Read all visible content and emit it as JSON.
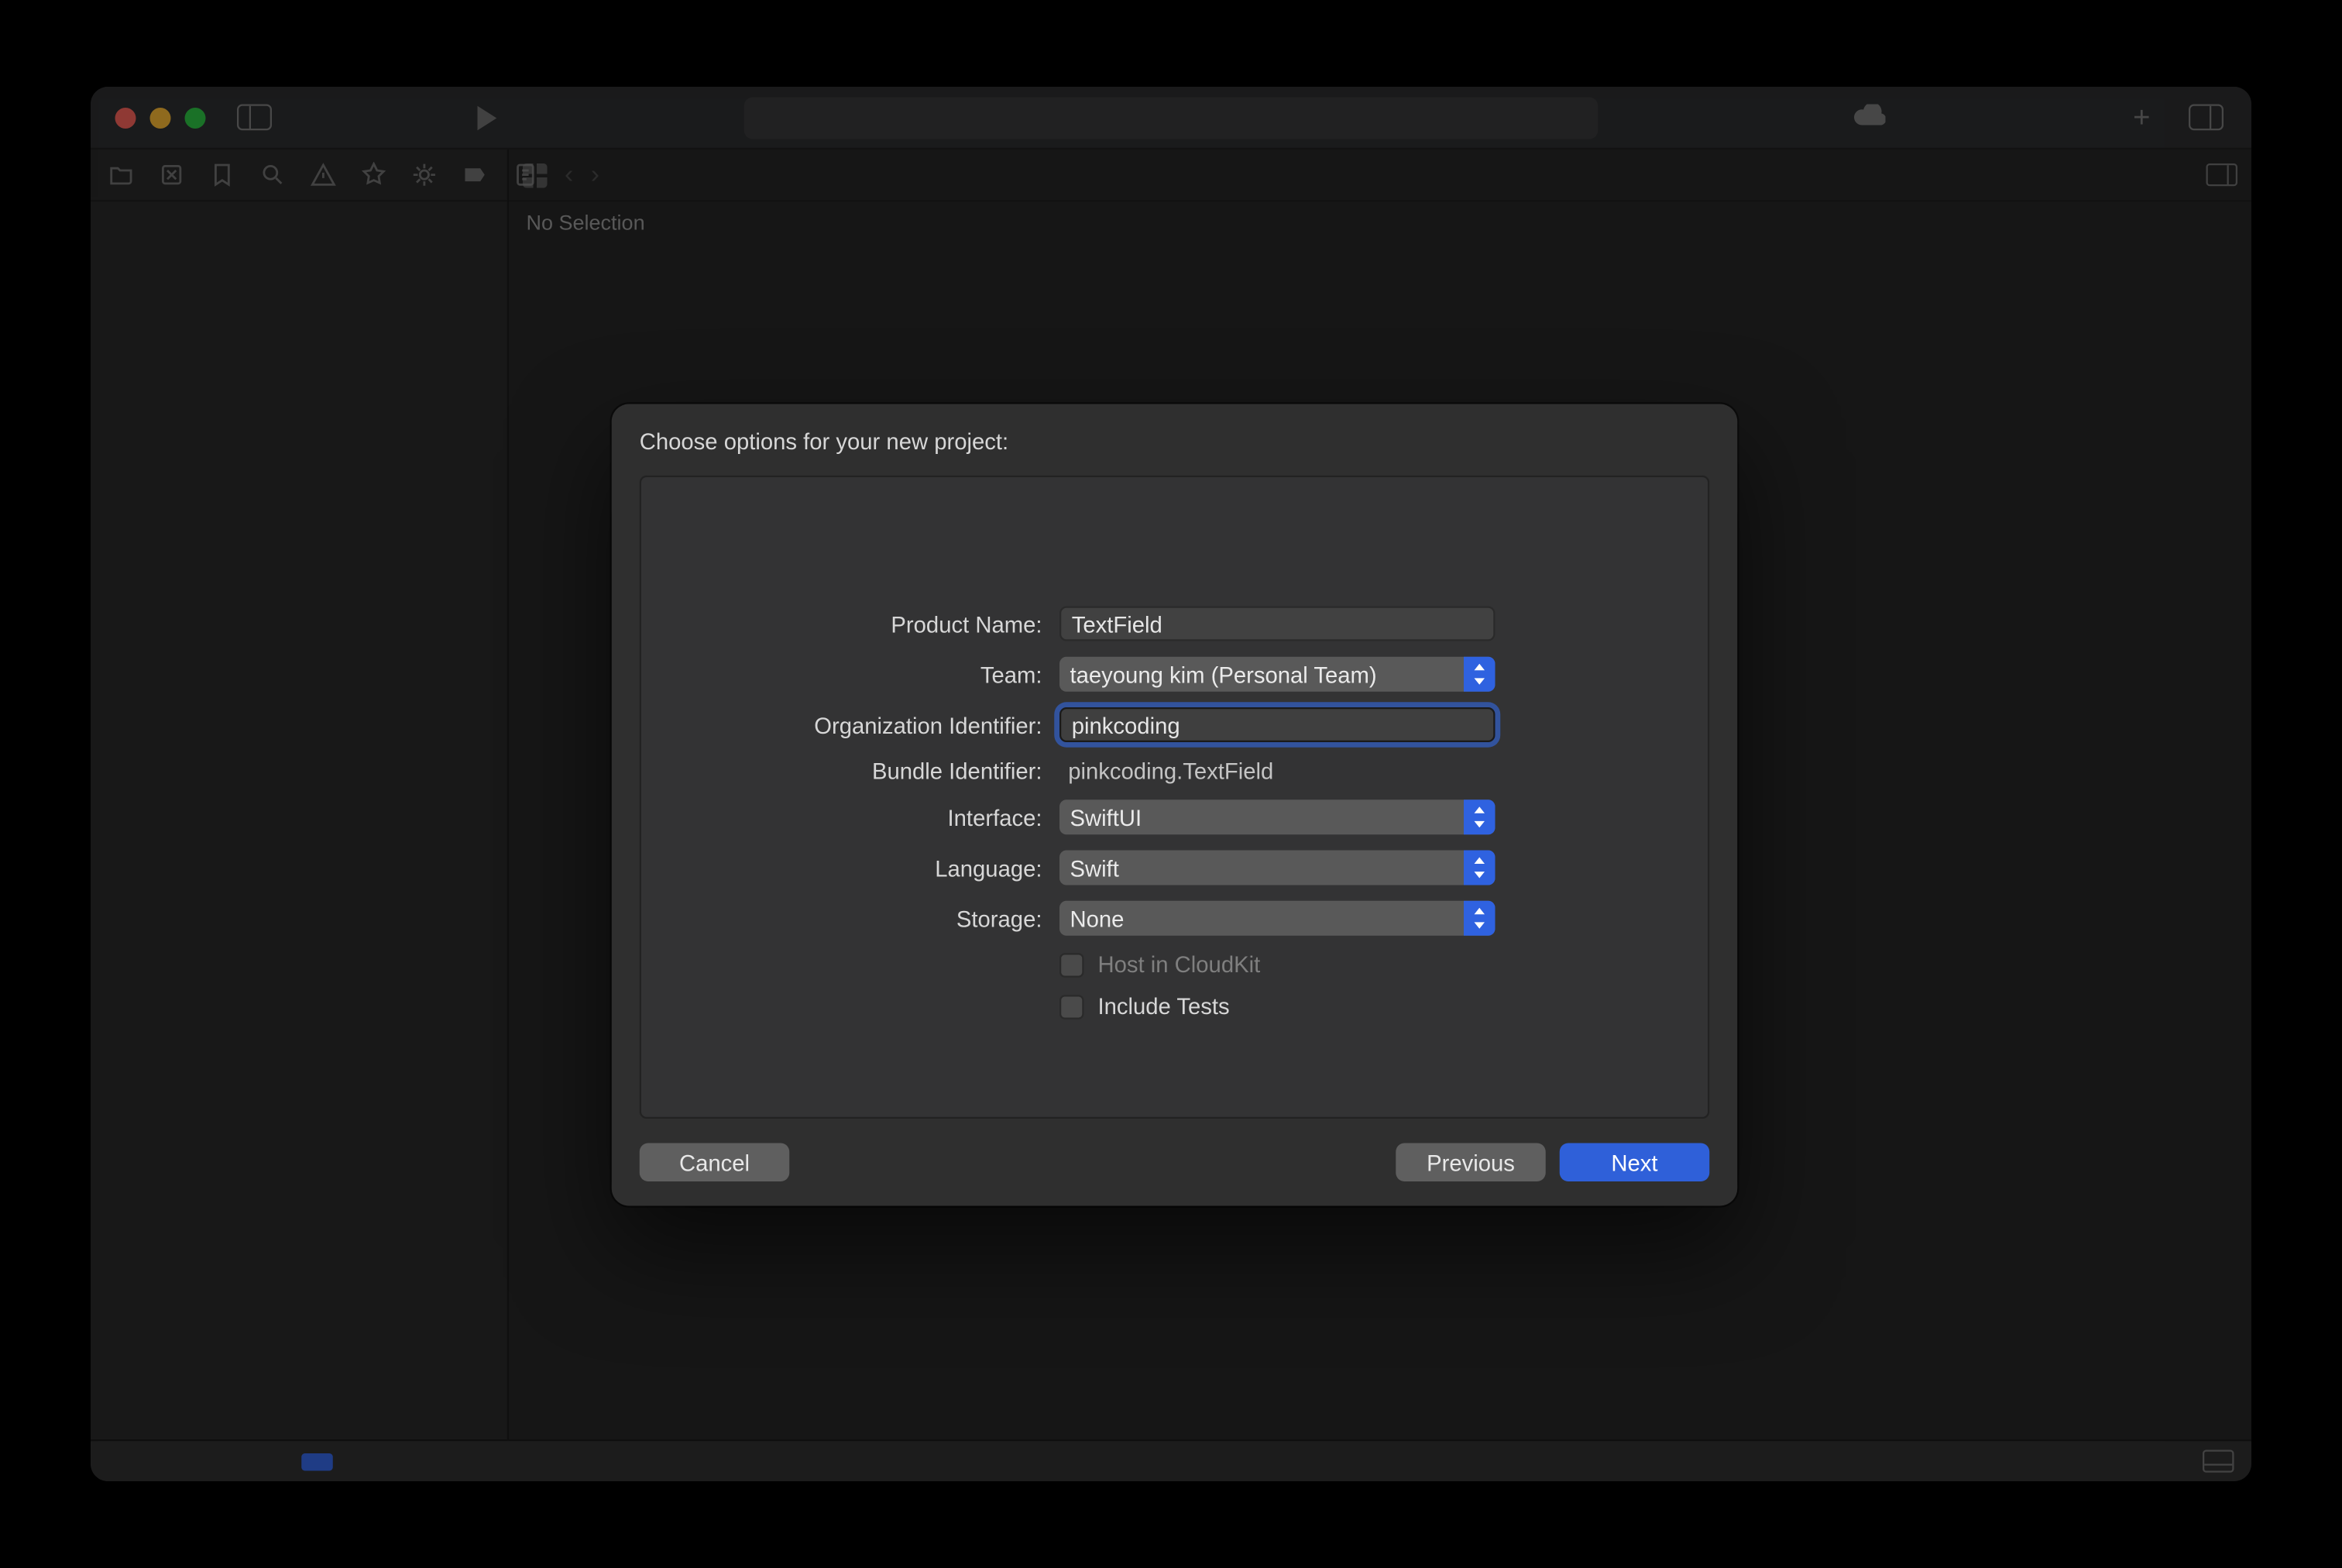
{
  "editor": {
    "no_selection": "No Selection"
  },
  "modal": {
    "title": "Choose options for your new project:",
    "labels": {
      "product_name": "Product Name:",
      "team": "Team:",
      "org_id": "Organization Identifier:",
      "bundle_id": "Bundle Identifier:",
      "interface": "Interface:",
      "language": "Language:",
      "storage": "Storage:"
    },
    "values": {
      "product_name": "TextField",
      "team": "taeyoung kim (Personal Team)",
      "org_id": "pinkcoding",
      "bundle_id": "pinkcoding.TextField",
      "interface": "SwiftUI",
      "language": "Swift",
      "storage": "None"
    },
    "checkboxes": {
      "cloudkit": "Host in CloudKit",
      "tests": "Include Tests"
    },
    "buttons": {
      "cancel": "Cancel",
      "previous": "Previous",
      "next": "Next"
    }
  }
}
